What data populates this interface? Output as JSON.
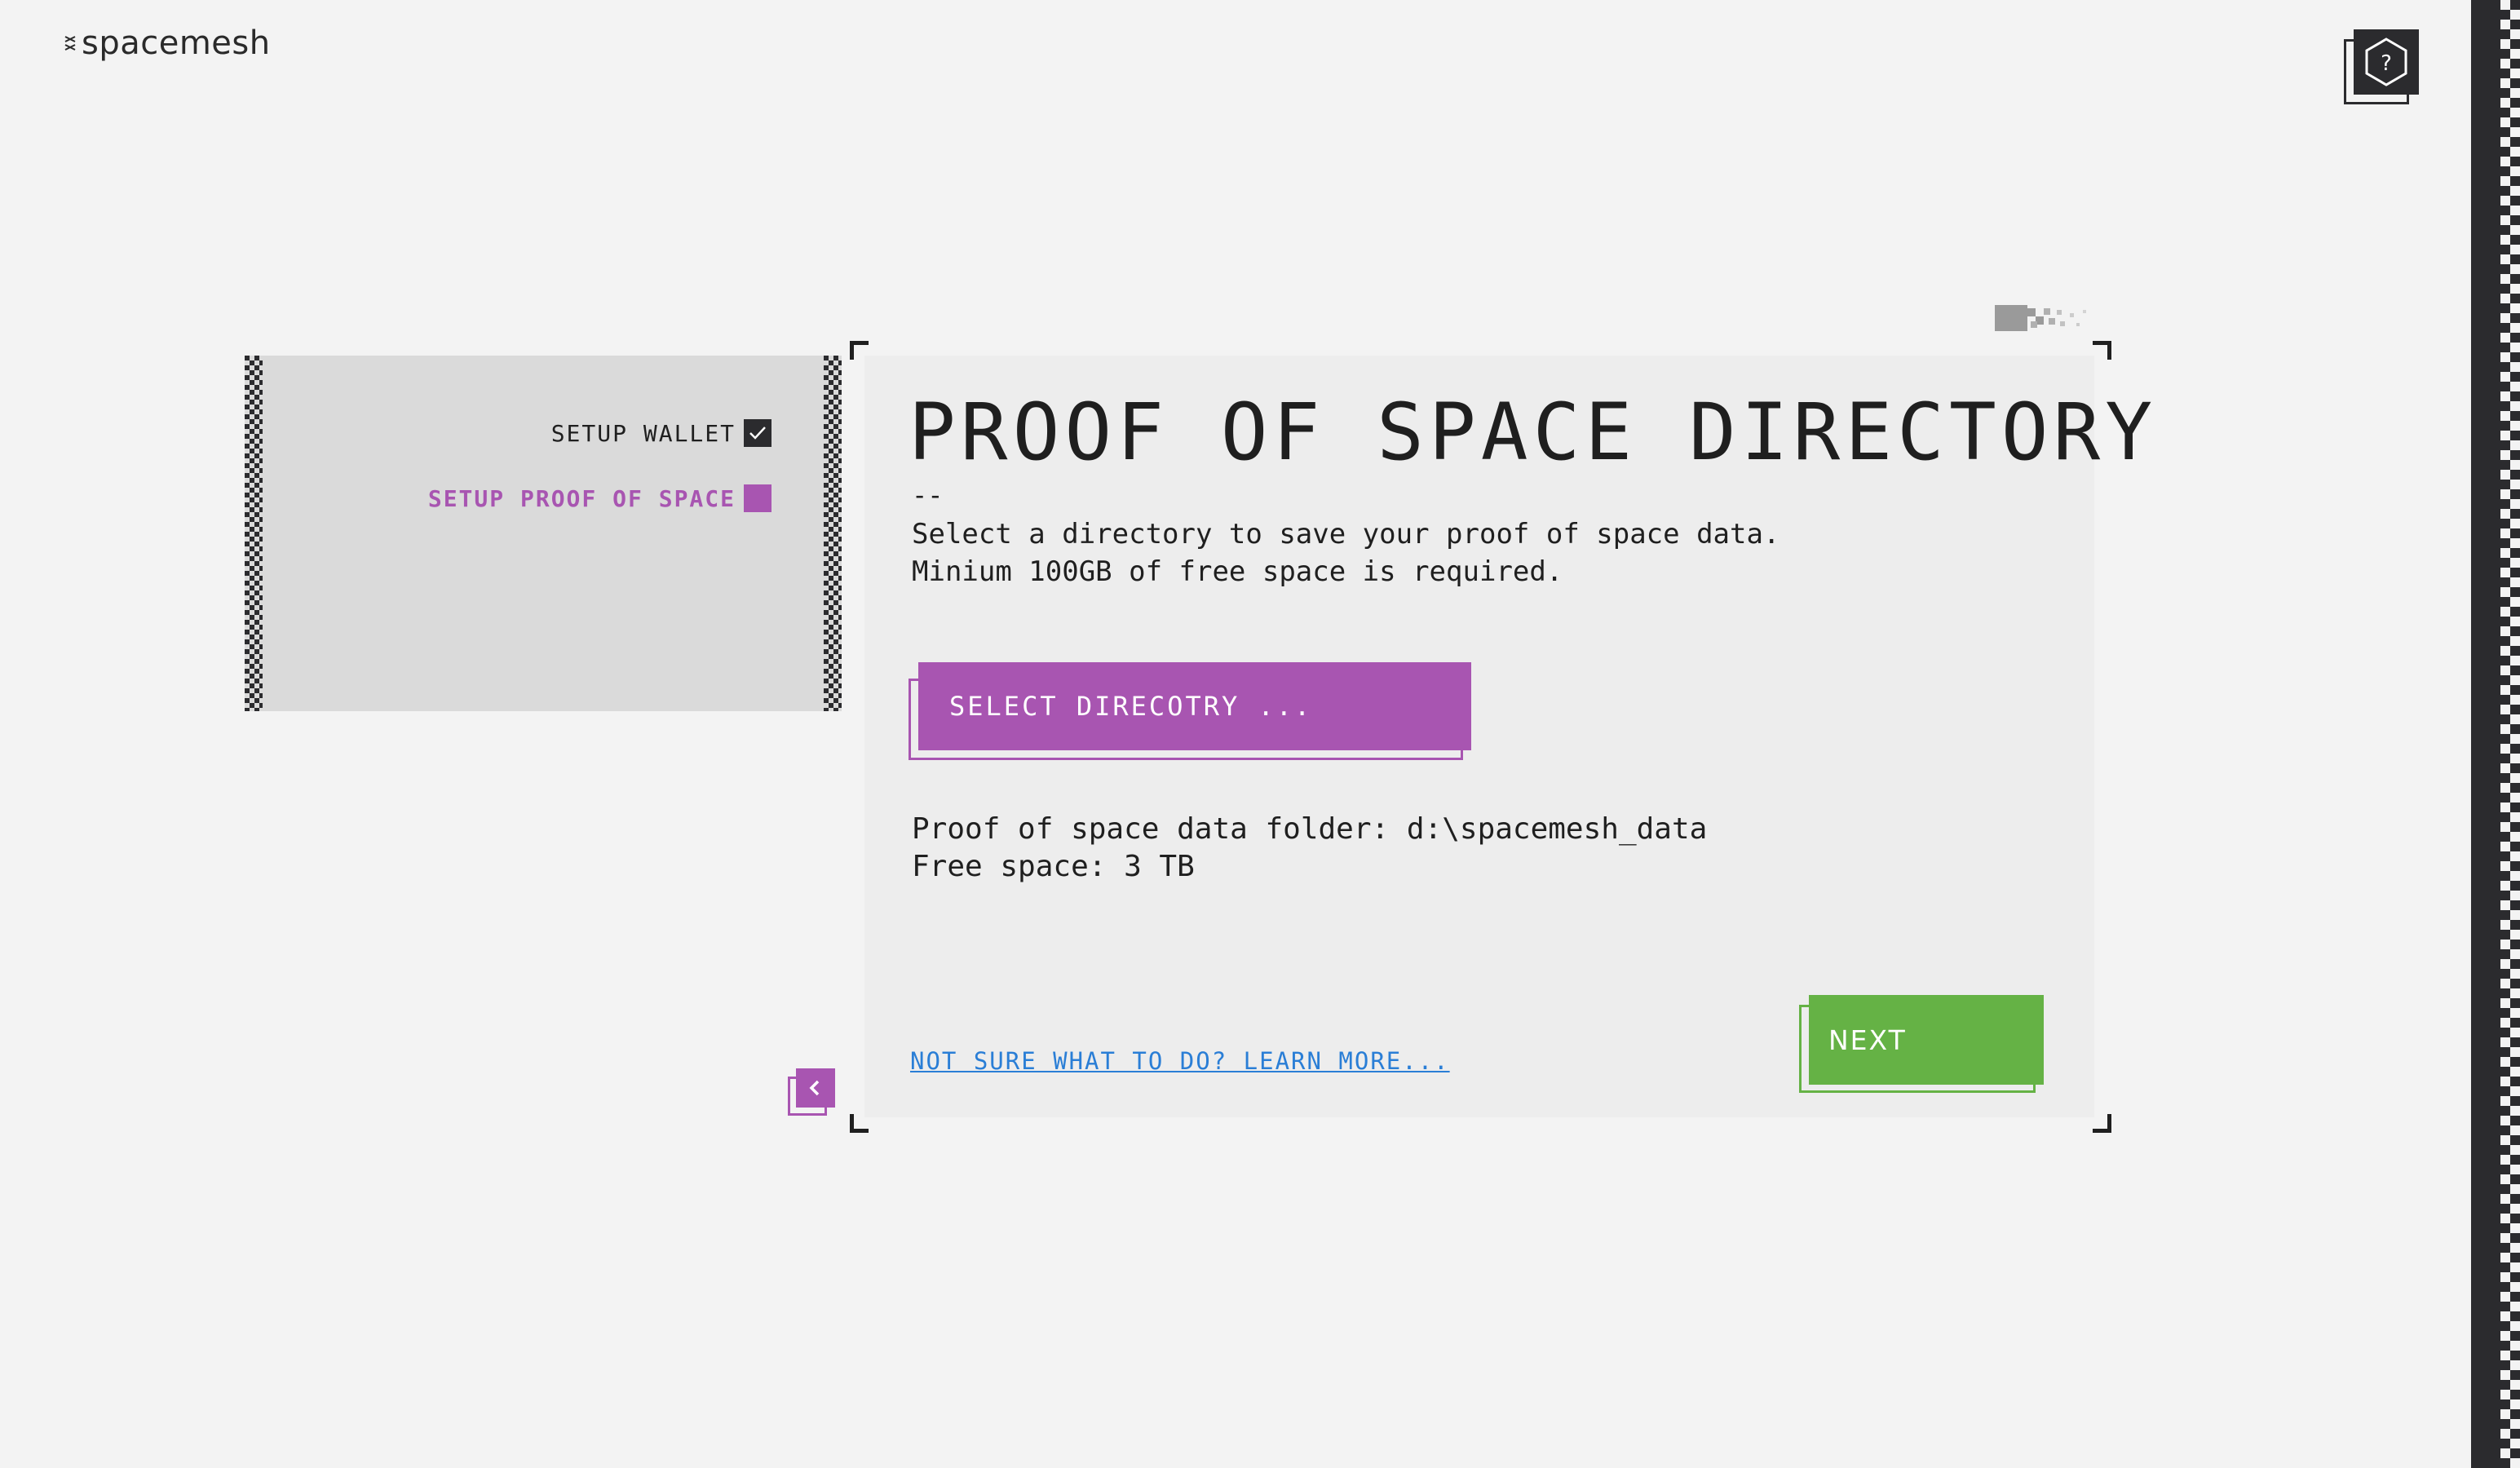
{
  "app": {
    "logo_text": "spacemesh"
  },
  "header": {
    "help_label": "?"
  },
  "steps": [
    {
      "label": "SETUP WALLET",
      "state": "complete"
    },
    {
      "label": "SETUP PROOF OF SPACE",
      "state": "active"
    }
  ],
  "main": {
    "title": "PROOF OF SPACE DIRECTORY",
    "separator": "--",
    "description_line1": "Select a directory to save your proof of space data.",
    "description_line2": "Minium 100GB of free space is required.",
    "select_button_label": "SELECT DIRECOTRY ...",
    "folder_line": "Proof of space data folder: d:\\spacemesh_data",
    "free_space_line": "Free space: 3 TB",
    "learn_more_link": "NOT SURE WHAT TO DO? LEARN MORE...",
    "next_button_label": "NEXT"
  },
  "colors": {
    "accent_purple": "#a855b1",
    "accent_green": "#65b245",
    "link_blue": "#2a7ed6",
    "dark": "#2b2b2e",
    "background": "#f3f3f3"
  },
  "icons": {
    "logo": "spacemesh-logo-icon",
    "help": "hexagon-question-icon",
    "step_complete": "checkmark-icon",
    "back": "chevron-left-icon"
  }
}
